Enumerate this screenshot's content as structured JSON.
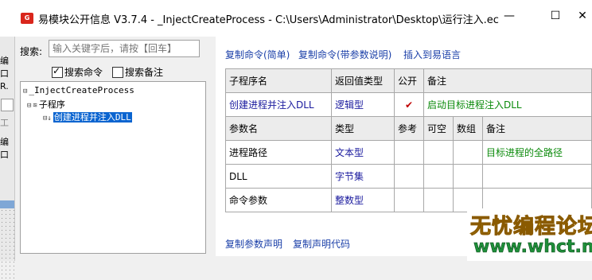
{
  "window": {
    "app_icon_label": "G",
    "title": "易模块公开信息 V3.7.4 - _InjectCreateProcess - C:\\Users\\Administrator\\Desktop\\运行注入.ec",
    "minimize": "—",
    "maximize": "☐",
    "close": "✕"
  },
  "background_window": {
    "fragment1": "编口",
    "fragment2": "R.",
    "fragment3": "工",
    "fragment4": "编口"
  },
  "search": {
    "label": "搜索:",
    "placeholder": "输入关键字后，请按【回车】",
    "option_commands": "搜索命令",
    "option_commands_checked": true,
    "option_notes": "搜索备注",
    "option_notes_checked": false
  },
  "tree": {
    "root": "_InjectCreateProcess",
    "group": "子程序",
    "item": "创建进程并注入DLL"
  },
  "toolbar": {
    "copy_simple": "复制命令(简单)",
    "copy_with_params": "复制命令(带参数说明)",
    "insert_lang": "插入到易语言"
  },
  "sub_table": {
    "headers": [
      "子程序名",
      "返回值类型",
      "公开",
      "备注"
    ],
    "row": {
      "name": "创建进程并注入DLL",
      "return_type": "逻辑型",
      "public_mark": "✔",
      "note": "启动目标进程注入DLL"
    }
  },
  "param_table": {
    "headers": [
      "参数名",
      "类型",
      "参考",
      "可空",
      "数组",
      "备注"
    ],
    "rows": [
      {
        "name": "进程路径",
        "type": "文本型",
        "note": "目标进程的全路径"
      },
      {
        "name": "DLL",
        "type": "字节集",
        "note": ""
      },
      {
        "name": "命令参数",
        "type": "整数型",
        "note": ""
      }
    ]
  },
  "footer": {
    "copy_param_decl": "复制参数声明",
    "copy_decl_code": "复制声明代码"
  },
  "watermark": {
    "line1": "无忧编程论坛",
    "line2": "www.whct.net"
  },
  "colors": {
    "link": "#1a3fa8",
    "type_text": "#1a1a9e",
    "note_green": "#0b8a0b",
    "check_red": "#c00000",
    "selection": "#0a64d0"
  }
}
